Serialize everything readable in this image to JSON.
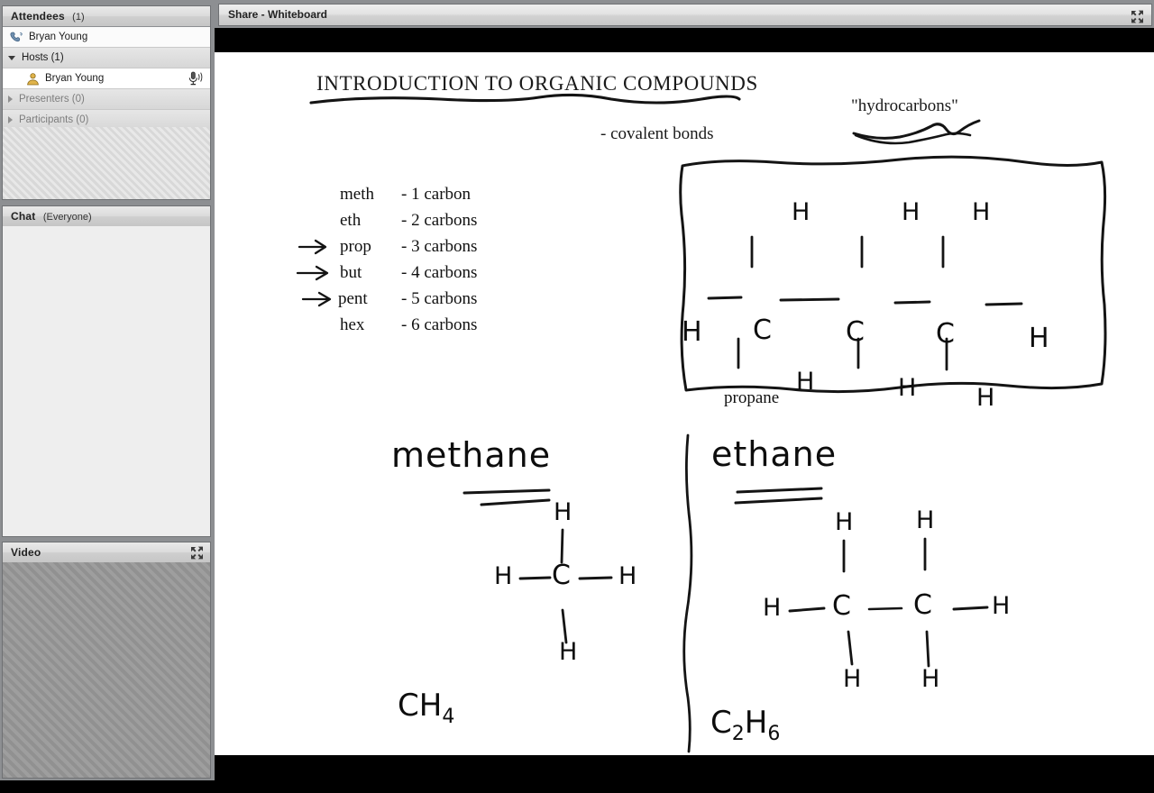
{
  "window": {
    "share_title": "Share - Whiteboard",
    "share_expand_icon": "expand-icon"
  },
  "sidebar": {
    "attendees": {
      "title": "Attendees",
      "count": "(1)",
      "self_row": {
        "name": "Bryan Young",
        "icon": "phone-handset-icon"
      },
      "groups": [
        {
          "label": "Hosts (1)",
          "expanded": true,
          "state_icon": "chevron-down-icon",
          "members": [
            {
              "name": "Bryan Young",
              "avatar_icon": "user-avatar-icon",
              "status_icon": "microphone-icon"
            }
          ]
        },
        {
          "label": "Presenters (0)",
          "expanded": false,
          "state_icon": "chevron-right-icon",
          "members": []
        },
        {
          "label": "Participants (0)",
          "expanded": false,
          "state_icon": "chevron-right-icon",
          "members": []
        }
      ]
    },
    "chat": {
      "title": "Chat",
      "scope": "(Everyone)",
      "messages": []
    },
    "video": {
      "title": "Video",
      "expand_icon": "expand-icon"
    }
  },
  "whiteboard": {
    "title": "INTRODUCTION TO ORGANIC COMPOUNDS",
    "notes": [
      {
        "id": "covalent",
        "text": "- covalent bonds"
      },
      {
        "id": "hydrocarbons",
        "text": "\"hydrocarbons\""
      }
    ],
    "prefix_list": [
      {
        "prefix": "meth",
        "value": "- 1 carbon",
        "arrow": false
      },
      {
        "prefix": "eth",
        "value": "- 2 carbons",
        "arrow": false
      },
      {
        "prefix": "prop",
        "value": "- 3 carbons",
        "arrow": true
      },
      {
        "prefix": "but",
        "value": "- 4 carbons",
        "arrow": true
      },
      {
        "prefix": "pent",
        "value": "- 5 carbons",
        "arrow": true
      },
      {
        "prefix": "hex",
        "value": "- 6 carbons",
        "arrow": false
      }
    ],
    "propane_box": {
      "label": "propane",
      "atoms": {
        "left_h": "H",
        "right_h": "H",
        "carbons": [
          "C",
          "C",
          "C"
        ],
        "top_h": [
          "H",
          "H",
          "H"
        ],
        "bottom_h": [
          "H",
          "H",
          "H"
        ]
      }
    },
    "methane": {
      "name": "methane",
      "atoms": {
        "center": "C",
        "top": "H",
        "left": "H",
        "right": "H",
        "bottom": "H"
      },
      "formula_base1": "CH",
      "formula_sub1": "4"
    },
    "ethane": {
      "name": "ethane",
      "atoms": {
        "carbons": [
          "C",
          "C"
        ],
        "left_h": "H",
        "right_h": "H",
        "top_h": [
          "H",
          "H"
        ],
        "bottom_h": [
          "H",
          "H"
        ]
      },
      "formula_base1": "C",
      "formula_sub1": "2",
      "formula_base2": "H",
      "formula_sub2": "6"
    }
  },
  "colors": {
    "ink": "#111111",
    "board_bg": "#ffffff",
    "chrome": "#8d8f92",
    "panel_head": "#d8d8d8"
  }
}
